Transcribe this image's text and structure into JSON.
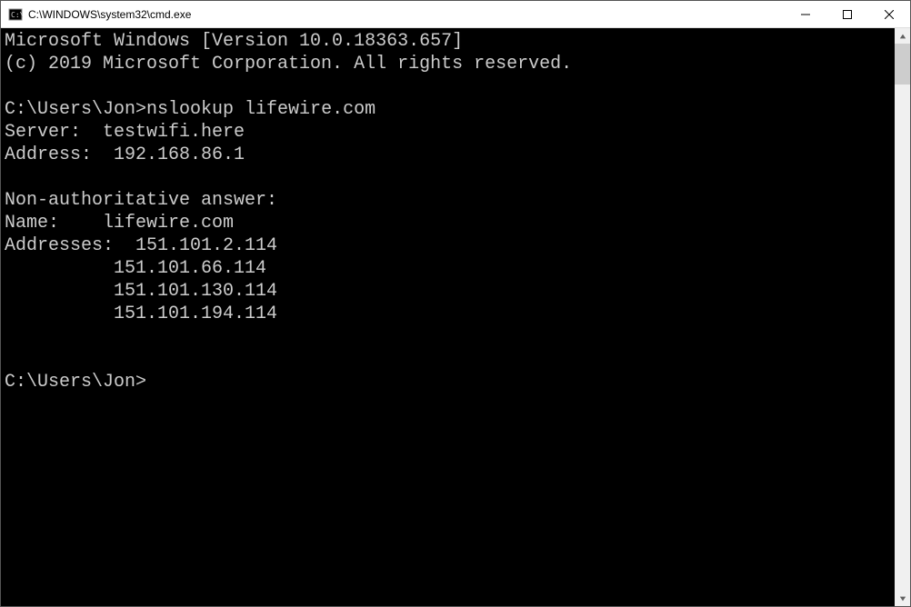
{
  "window": {
    "title": "C:\\WINDOWS\\system32\\cmd.exe"
  },
  "terminal": {
    "banner_line1": "Microsoft Windows [Version 10.0.18363.657]",
    "banner_line2": "(c) 2019 Microsoft Corporation. All rights reserved.",
    "prompt1": "C:\\Users\\Jon>",
    "command1": "nslookup lifewire.com",
    "server_label": "Server:  ",
    "server_value": "testwifi.here",
    "address_label": "Address:  ",
    "address_value": "192.168.86.1",
    "nonauth_header": "Non-authoritative answer:",
    "name_label": "Name:    ",
    "name_value": "lifewire.com",
    "addresses_label": "Addresses:  ",
    "addresses": [
      "151.101.2.114",
      "151.101.66.114",
      "151.101.130.114",
      "151.101.194.114"
    ],
    "addr_indent": "          ",
    "prompt2": "C:\\Users\\Jon>"
  }
}
